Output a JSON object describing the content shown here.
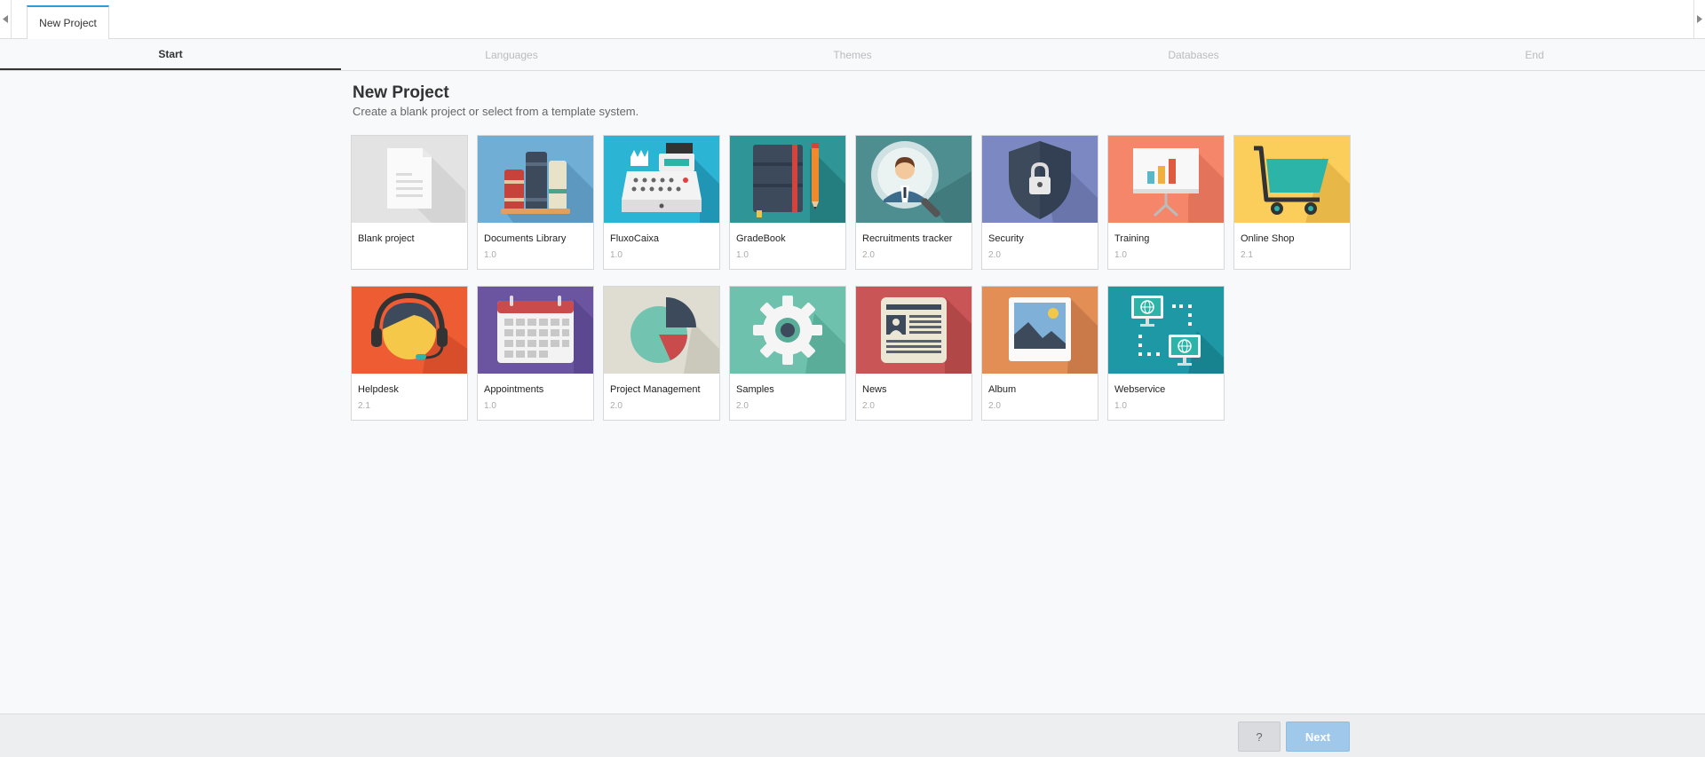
{
  "document_tab": {
    "label": "New Project"
  },
  "steps": [
    "Start",
    "Languages",
    "Themes",
    "Databases",
    "End"
  ],
  "active_step": "Start",
  "heading": {
    "title": "New Project",
    "subtitle": "Create a blank project or select from a template system."
  },
  "templates": [
    {
      "name": "Blank project",
      "version": "",
      "icon": "blank-document-icon",
      "color": "#e3e3e3"
    },
    {
      "name": "Documents Library",
      "version": "1.0",
      "icon": "books-icon",
      "color": "#70aed6"
    },
    {
      "name": "FluxoCaixa",
      "version": "1.0",
      "icon": "cash-register-icon",
      "color": "#2cb4d4"
    },
    {
      "name": "GradeBook",
      "version": "1.0",
      "icon": "notebook-icon",
      "color": "#2f9596"
    },
    {
      "name": "Recruitments tracker",
      "version": "2.0",
      "icon": "magnifier-person-icon",
      "color": "#4f8e90"
    },
    {
      "name": "Security",
      "version": "2.0",
      "icon": "shield-lock-icon",
      "color": "#7c88c2"
    },
    {
      "name": "Training",
      "version": "1.0",
      "icon": "presentation-board-icon",
      "color": "#f5866a"
    },
    {
      "name": "Online Shop",
      "version": "2.1",
      "icon": "shopping-cart-icon",
      "color": "#fbce5c"
    },
    {
      "name": "Helpdesk",
      "version": "2.1",
      "icon": "headset-agent-icon",
      "color": "#ee5c34"
    },
    {
      "name": "Appointments",
      "version": "1.0",
      "icon": "calendar-icon",
      "color": "#6b55a0"
    },
    {
      "name": "Project Management",
      "version": "2.0",
      "icon": "pie-chart-icon",
      "color": "#dfddd2"
    },
    {
      "name": "Samples",
      "version": "2.0",
      "icon": "gear-icon",
      "color": "#6dc1ad"
    },
    {
      "name": "News",
      "version": "2.0",
      "icon": "newspaper-icon",
      "color": "#c95556"
    },
    {
      "name": "Album",
      "version": "2.0",
      "icon": "photo-icon",
      "color": "#e28e55"
    },
    {
      "name": "Webservice",
      "version": "1.0",
      "icon": "network-globe-icon",
      "color": "#1d98a4"
    }
  ],
  "footer": {
    "help_label": "?",
    "next_label": "Next"
  }
}
